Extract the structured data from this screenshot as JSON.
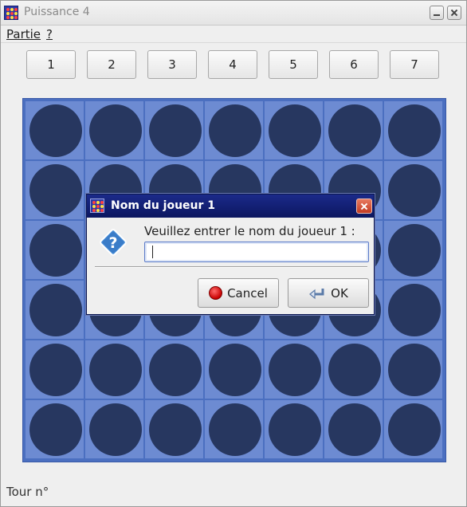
{
  "window": {
    "title": "Puissance 4"
  },
  "menu": {
    "items": [
      {
        "label": "Partie"
      },
      {
        "label": "?"
      }
    ]
  },
  "columns": {
    "labels": [
      "1",
      "2",
      "3",
      "4",
      "5",
      "6",
      "7"
    ]
  },
  "board": {
    "columns": 7,
    "rows": 6,
    "hole_color": "#273760",
    "board_color": "#4b6fc0",
    "cell_color": "#6d8bd2"
  },
  "status": {
    "label": "Tour n°"
  },
  "dialog": {
    "title": "Nom du joueur 1",
    "prompt": "Veuillez entrer le nom du joueur 1 :",
    "input_value": "",
    "cancel_label": "Cancel",
    "ok_label": "OK",
    "icon": "question-icon"
  }
}
